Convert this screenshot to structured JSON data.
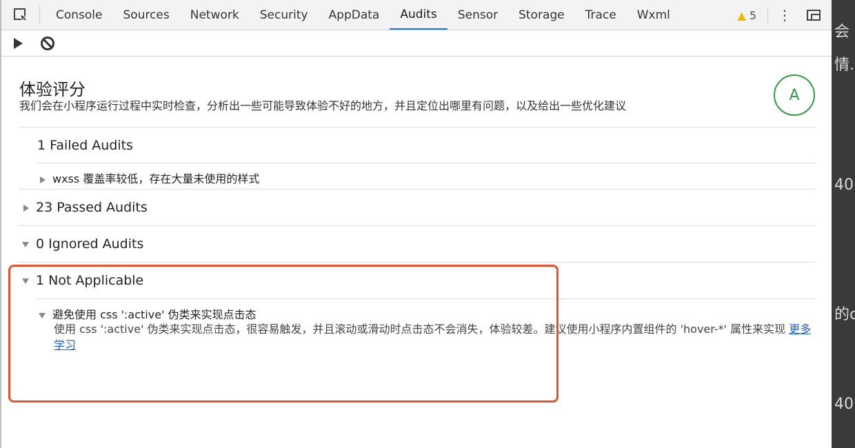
{
  "tabs": [
    "Console",
    "Sources",
    "Network",
    "Security",
    "AppData",
    "Audits",
    "Sensor",
    "Storage",
    "Trace",
    "Wxml"
  ],
  "active_tab": "Audits",
  "warnings": {
    "count": "5"
  },
  "icons": {
    "inspect": "inspect-element-icon",
    "warning": "warning-icon",
    "more": "more-vert-icon",
    "dock": "dock-side-icon",
    "run": "play-icon",
    "clear": "clear-block-icon"
  },
  "score": {
    "title": "体验评分",
    "description": "我们会在小程序运行过程中实时检查，分析出一些可能导致体验不好的地方，并且定位出哪里有问题，以及给出一些优化建议",
    "grade": "A"
  },
  "sections": {
    "failed": {
      "title": "1 Failed Audits",
      "items": [
        "wxss 覆盖率较低，存在大量未使用的样式"
      ]
    },
    "passed": {
      "title": "23 Passed Audits"
    },
    "ignored": {
      "title": "0 Ignored Audits"
    },
    "not_applicable": {
      "title": "1 Not Applicable",
      "item_title": "避免使用 css ':active' 伪类来实现点击态",
      "item_desc": "使用 css ':active' 伪类来实现点击态，很容易触发，并且滚动或滑动时点击态不会消失，体验较差。建议使用小程序内置组件的 'hover-*' 属性来实现",
      "learn_more": "更多学习"
    }
  },
  "background_page_text": [
    "会",
    "情.",
    "40",
    "的c",
    "40"
  ],
  "colors": {
    "accent": "#1a73e8",
    "grade": "#2e9b45",
    "highlight": "#e8522c",
    "link": "#1a5fd6",
    "warning": "#f2b600"
  }
}
